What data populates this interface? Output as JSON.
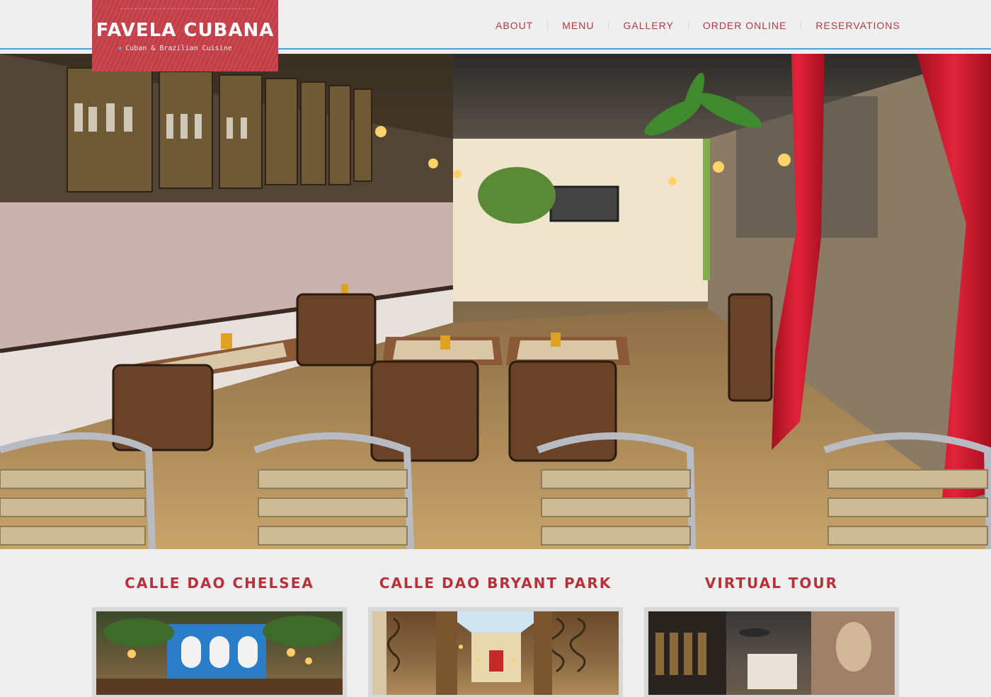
{
  "brand": {
    "name": "FAVELA CUBANA",
    "tagline": "Cuban & Brazilian Cuisine"
  },
  "nav": {
    "items": [
      {
        "label": "ABOUT"
      },
      {
        "label": "MENU"
      },
      {
        "label": "GALLERY"
      },
      {
        "label": "ORDER ONLINE"
      },
      {
        "label": "RESERVATIONS"
      }
    ]
  },
  "sections": [
    {
      "title": "CALLE DAO CHELSEA"
    },
    {
      "title": "CALLE DAO BRYANT PARK"
    },
    {
      "title": "VIRTUAL TOUR"
    }
  ],
  "colors": {
    "brand_red": "#c8404a",
    "nav_text": "#b53a3f",
    "header_line": "#4a9fd6",
    "background": "#eeeeee"
  },
  "icons": {
    "logo_star": "star-icon",
    "play": "play-icon"
  }
}
